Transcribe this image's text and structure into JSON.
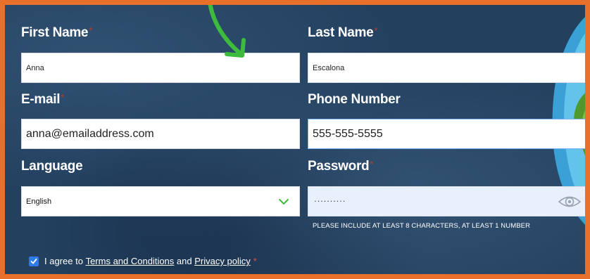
{
  "form": {
    "first_name": {
      "label": "First Name",
      "required_mark": "*",
      "value": "Anna"
    },
    "last_name": {
      "label": "Last Name",
      "required_mark": "*",
      "value": "Escalona"
    },
    "email": {
      "label": "E-mail",
      "required_mark": "*",
      "value": "anna@emailaddress.com"
    },
    "phone": {
      "label": "Phone Number",
      "value": "555-555-5555"
    },
    "language": {
      "label": "Language",
      "selected": "English"
    },
    "password": {
      "label": "Password",
      "required_mark": "*",
      "masked_value": "··········",
      "hint": "PLEASE INCLUDE AT LEAST 8 CHARACTERS, AT LEAST 1 NUMBER"
    },
    "agree": {
      "text_before": "I agree to",
      "terms_link": "Terms and Conditions",
      "text_between": "and",
      "privacy_link": "Privacy policy",
      "required_mark": "*",
      "checked": true
    }
  },
  "colors": {
    "frame_border": "#e8702a",
    "background": "#23405f",
    "arrow": "#3dbb3d",
    "required": "#c0392b",
    "checkbox": "#2d7be5",
    "password_bg": "#e8f0fe"
  },
  "icons": [
    "arrow-icon",
    "chevron-down-icon",
    "eye-icon",
    "checkmark-icon"
  ]
}
